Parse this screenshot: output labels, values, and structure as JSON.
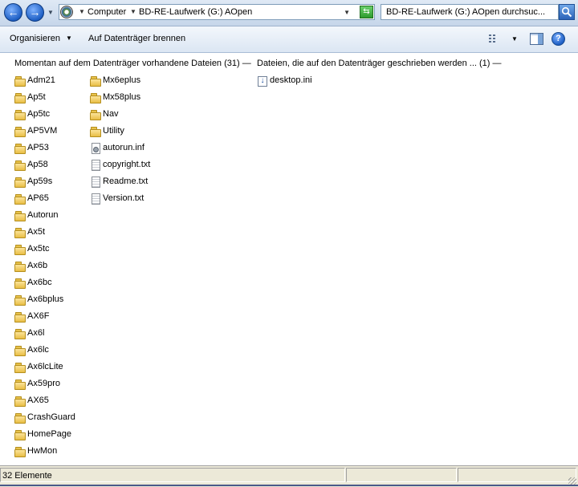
{
  "address_bar": {
    "breadcrumbs": [
      "Computer",
      "BD-RE-Laufwerk (G:) AOpen"
    ],
    "search_placeholder": "BD-RE-Laufwerk (G:) AOpen durchsuc..."
  },
  "command_bar": {
    "organize_label": "Organisieren",
    "burn_label": "Auf Datenträger brennen"
  },
  "groups": {
    "on_disc_header": "Momentan auf dem Datenträger vorhandene Dateien (31) —",
    "to_write_header": "Dateien, die auf den Datenträger geschrieben werden ... (1) —"
  },
  "on_disc_files": [
    {
      "name": "Adm21",
      "type": "folder"
    },
    {
      "name": "Ap5t",
      "type": "folder"
    },
    {
      "name": "Ap5tc",
      "type": "folder"
    },
    {
      "name": "AP5VM",
      "type": "folder"
    },
    {
      "name": "AP53",
      "type": "folder"
    },
    {
      "name": "Ap58",
      "type": "folder"
    },
    {
      "name": "Ap59s",
      "type": "folder"
    },
    {
      "name": "AP65",
      "type": "folder"
    },
    {
      "name": "Autorun",
      "type": "folder"
    },
    {
      "name": "Ax5t",
      "type": "folder"
    },
    {
      "name": "Ax5tc",
      "type": "folder"
    },
    {
      "name": "Ax6b",
      "type": "folder"
    },
    {
      "name": "Ax6bc",
      "type": "folder"
    },
    {
      "name": "Ax6bplus",
      "type": "folder"
    },
    {
      "name": "AX6F",
      "type": "folder"
    },
    {
      "name": "Ax6l",
      "type": "folder"
    },
    {
      "name": "Ax6lc",
      "type": "folder"
    },
    {
      "name": "Ax6lcLite",
      "type": "folder"
    },
    {
      "name": "Ax59pro",
      "type": "folder"
    },
    {
      "name": "AX65",
      "type": "folder"
    },
    {
      "name": "CrashGuard",
      "type": "folder"
    },
    {
      "name": "HomePage",
      "type": "folder"
    },
    {
      "name": "HwMon",
      "type": "folder"
    },
    {
      "name": "Mx6eplus",
      "type": "folder"
    },
    {
      "name": "Mx58plus",
      "type": "folder"
    },
    {
      "name": "Nav",
      "type": "folder"
    },
    {
      "name": "Utility",
      "type": "folder"
    },
    {
      "name": "autorun.inf",
      "type": "inf"
    },
    {
      "name": "copyright.txt",
      "type": "txt"
    },
    {
      "name": "Readme.txt",
      "type": "txt"
    },
    {
      "name": "Version.txt",
      "type": "txt"
    }
  ],
  "to_write_files": [
    {
      "name": "desktop.ini",
      "type": "ini"
    }
  ],
  "status_bar": {
    "item_count": "32 Elemente"
  },
  "icons": {
    "back": "back-arrow-icon",
    "forward": "forward-arrow-icon",
    "drive": "disc-drive-icon",
    "refresh": "refresh-icon",
    "search": "search-icon",
    "views": "views-icon",
    "preview_pane": "preview-pane-icon",
    "help": "help-icon",
    "folder": "folder-icon",
    "text_file": "text-file-icon",
    "settings_file": "settings-file-icon"
  }
}
